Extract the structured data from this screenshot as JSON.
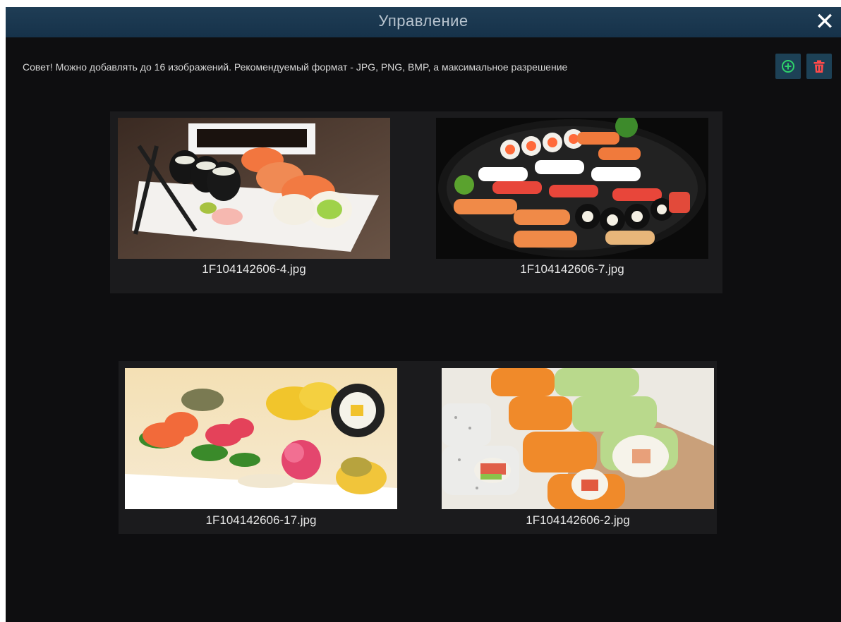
{
  "window": {
    "title": "Управление",
    "close_icon": "close-icon"
  },
  "toolbar": {
    "tip": "Совет! Можно добавлять до 16 изображений. Рекомендуемый формат - JPG, PNG, BMP, а максимальное разрешение",
    "add_icon": "add-circle-icon",
    "delete_icon": "trash-icon",
    "add_color": "#2fd26a",
    "delete_color": "#ff4a4a"
  },
  "images": [
    {
      "filename": "1F104142606-4.jpg"
    },
    {
      "filename": "1F104142606-7.jpg"
    },
    {
      "filename": "1F104142606-17.jpg"
    },
    {
      "filename": "1F104142606-2.jpg"
    }
  ]
}
